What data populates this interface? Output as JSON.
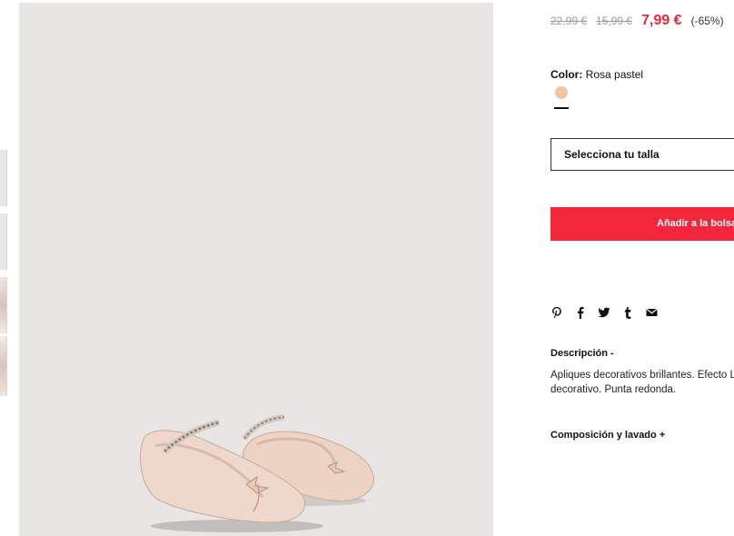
{
  "gallery": {
    "thumbnail_count": 4,
    "main_image_alt": "Bailarinas rosa pastel con apliques decorativos brillantes"
  },
  "product": {
    "prices": {
      "original": "22,99 €",
      "previous": "15,99 €",
      "current": "7,99 €",
      "discount": "(-65%)"
    },
    "color": {
      "label": "Color:",
      "value": "Rosa pastel",
      "swatch_hex": "#f2c4a0"
    },
    "size_select": {
      "placeholder": "Selecciona tu talla"
    },
    "add_to_bag_label": "Añadir a la bolsa",
    "share_icons": [
      "pinterest-icon",
      "facebook-icon",
      "twitter-icon",
      "tumblr-icon",
      "email-icon"
    ],
    "description": {
      "title": "Descripción",
      "toggle": "-",
      "text": "Apliques decorativos brillantes. Efecto Lazo decorativo. Punta redonda."
    },
    "composition": {
      "title": "Composición y lavado",
      "toggle": "+"
    }
  },
  "colors": {
    "sale_red": "#e7253b",
    "button_red": "#f4263b",
    "image_background": "#e8e6e4"
  }
}
